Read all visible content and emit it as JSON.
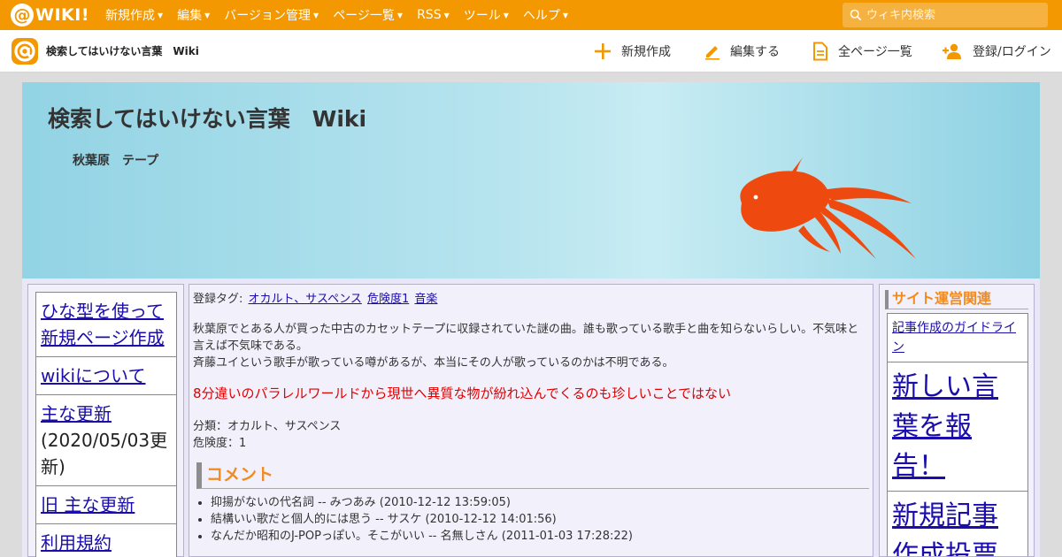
{
  "topbar": {
    "logo_text": "WIKI!",
    "menus": [
      {
        "label": "新規作成"
      },
      {
        "label": "編集"
      },
      {
        "label": "バージョン管理"
      },
      {
        "label": "ページ一覧"
      },
      {
        "label": "RSS"
      },
      {
        "label": "ツール"
      },
      {
        "label": "ヘルプ"
      }
    ],
    "search_placeholder": "ウィキ内検索",
    "color": "#f39800"
  },
  "subbar": {
    "title": "検索してはいけない言葉　Wiki",
    "actions": [
      {
        "label": "新規作成",
        "icon": "plus-icon"
      },
      {
        "label": "編集する",
        "icon": "pencil-icon"
      },
      {
        "label": "全ページ一覧",
        "icon": "document-icon"
      },
      {
        "label": "登録/ログイン",
        "icon": "user-add-icon"
      }
    ]
  },
  "header": {
    "title": "検索してはいけない言葉　Wiki",
    "page_name": "秋葉原　テープ"
  },
  "left_nav": {
    "items": [
      {
        "label": "ひな型を使って新規ページ作成",
        "note": ""
      },
      {
        "label": "wikiについて",
        "note": ""
      },
      {
        "label": "主な更新",
        "note": "(2020/05/03更新)"
      },
      {
        "label": "旧 主な更新",
        "note": ""
      },
      {
        "label": "利用規約",
        "note": ""
      }
    ]
  },
  "article": {
    "tags_label": "登録タグ:",
    "tags": [
      "オカルト、サスペンス",
      "危険度1",
      "音楽"
    ],
    "desc_1": "秋葉原でとある人が買った中古のカセットテープに収録されていた謎の曲。誰も歌っている歌手と曲を知らないらしい。不気味と言えば不気味である。",
    "desc_2": "斉藤ユイという歌手が歌っている噂があるが、本当にその人が歌っているのかは不明である。",
    "red_note": "8分違いのパラレルワールドから現世へ異質な物が紛れ込んでくるのも珍しいことではない",
    "category": "分類：オカルト、サスペンス",
    "danger": "危険度：1",
    "comment_heading": "コメント",
    "comments": [
      "抑揚がないの代名詞 -- みつあみ (2010-12-12 13:59:05)",
      "結構いい歌だと個人的には思う -- サスケ (2010-12-12 14:01:56)",
      "なんだか昭和のJ-POPっぽい。そこがいい -- 名無しさん (2011-01-03 17:28:22)"
    ]
  },
  "right_nav": {
    "heading": "サイト運営関連",
    "items": [
      {
        "label": "記事作成のガイドライン",
        "size": "small"
      },
      {
        "label": "新しい言葉を報告！",
        "size": "big"
      },
      {
        "label": "新規記事作成投票",
        "size": "big"
      }
    ]
  },
  "colors": {
    "accent_orange": "#f38a1d",
    "link": "#1a0dab",
    "alert_red": "#e00000",
    "fish": "#ee4a10"
  }
}
